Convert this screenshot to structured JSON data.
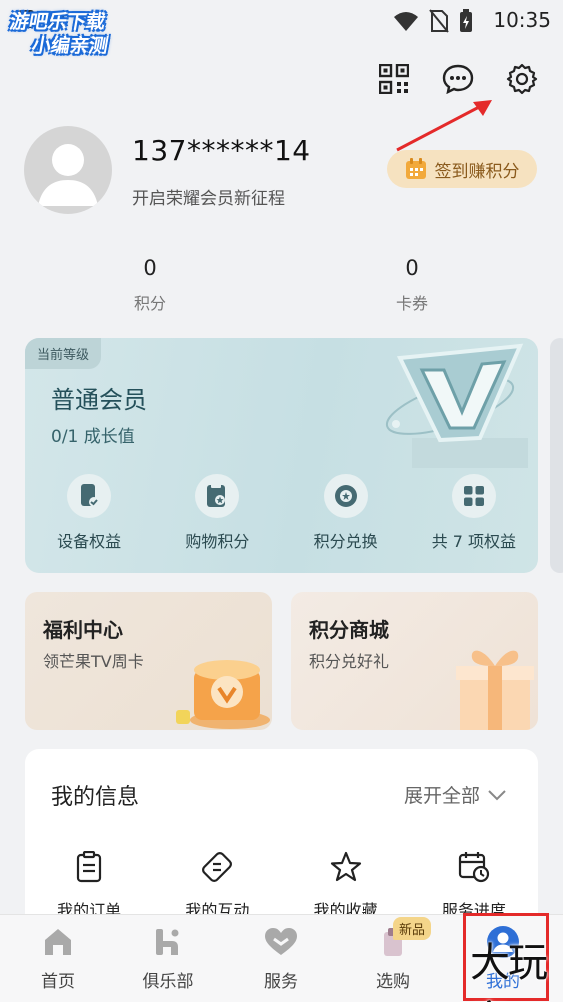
{
  "status_bar": {
    "time": "10:35"
  },
  "watermark": {
    "line1": "游吧乐下载",
    "line2": "小编亲测"
  },
  "profile": {
    "phone": "137******14",
    "slogan": "开启荣耀会员新征程",
    "signin_label": "签到赚积分"
  },
  "stats": [
    {
      "value": "0",
      "label": "积分"
    },
    {
      "value": "0",
      "label": "卡券"
    }
  ],
  "member_card": {
    "tag": "当前等级",
    "title": "普通会员",
    "growth": "0/1 成长值",
    "benefits": [
      {
        "label": "设备权益",
        "icon": "device-benefit-icon"
      },
      {
        "label": "购物积分",
        "icon": "shopping-points-icon"
      },
      {
        "label": "积分兑换",
        "icon": "points-exchange-icon"
      },
      {
        "label": "共 7 项权益",
        "icon": "grid-icon"
      }
    ]
  },
  "cards": {
    "welfare": {
      "title": "福利中心",
      "subtitle": "领芒果TV周卡"
    },
    "mall": {
      "title": "积分商城",
      "subtitle": "积分兑好礼"
    }
  },
  "my_info": {
    "title": "我的信息",
    "expand_label": "展开全部",
    "items": [
      {
        "label": "我的订单",
        "icon": "order-icon"
      },
      {
        "label": "我的互动",
        "icon": "interaction-icon"
      },
      {
        "label": "我的收藏",
        "icon": "star-icon"
      },
      {
        "label": "服务进度",
        "icon": "calendar-clock-icon"
      }
    ]
  },
  "tabbar": {
    "items": [
      {
        "label": "首页",
        "icon": "home-icon"
      },
      {
        "label": "俱乐部",
        "icon": "club-icon"
      },
      {
        "label": "服务",
        "icon": "heart-icon"
      },
      {
        "label": "选购",
        "icon": "shop-icon",
        "badge": "新品"
      },
      {
        "label": "我的",
        "icon": "user-icon",
        "active": true
      }
    ]
  },
  "corner_watermark": "大玩家",
  "colors": {
    "accent": "#2e6fd6",
    "signin_bg": "#f6e2c0",
    "annotation_red": "#e42a2a"
  }
}
